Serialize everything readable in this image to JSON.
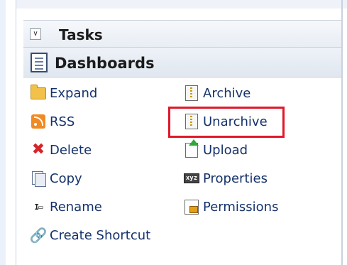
{
  "tasks_panel": {
    "collapse_glyph": "∨",
    "title": "Tasks"
  },
  "dashboards": {
    "title": "Dashboards"
  },
  "actions_left": [
    {
      "label": "Expand",
      "icon": "folder-open-icon"
    },
    {
      "label": "RSS",
      "icon": "rss-icon"
    },
    {
      "label": "Delete",
      "icon": "delete-x-icon"
    },
    {
      "label": "Copy",
      "icon": "copy-icon"
    },
    {
      "label": "Rename",
      "icon": "rename-icon"
    },
    {
      "label": "Create Shortcut",
      "icon": "shortcut-link-icon"
    }
  ],
  "actions_right": [
    {
      "label": "Archive",
      "icon": "zip-file-icon"
    },
    {
      "label": "Unarchive",
      "icon": "zip-file-icon",
      "highlighted": true
    },
    {
      "label": "Upload",
      "icon": "upload-icon"
    },
    {
      "label": "Properties",
      "icon": "properties-icon"
    },
    {
      "label": "Permissions",
      "icon": "permissions-lock-icon"
    }
  ],
  "colors": {
    "link_text": "#15326b",
    "highlight": "#e0182a"
  }
}
